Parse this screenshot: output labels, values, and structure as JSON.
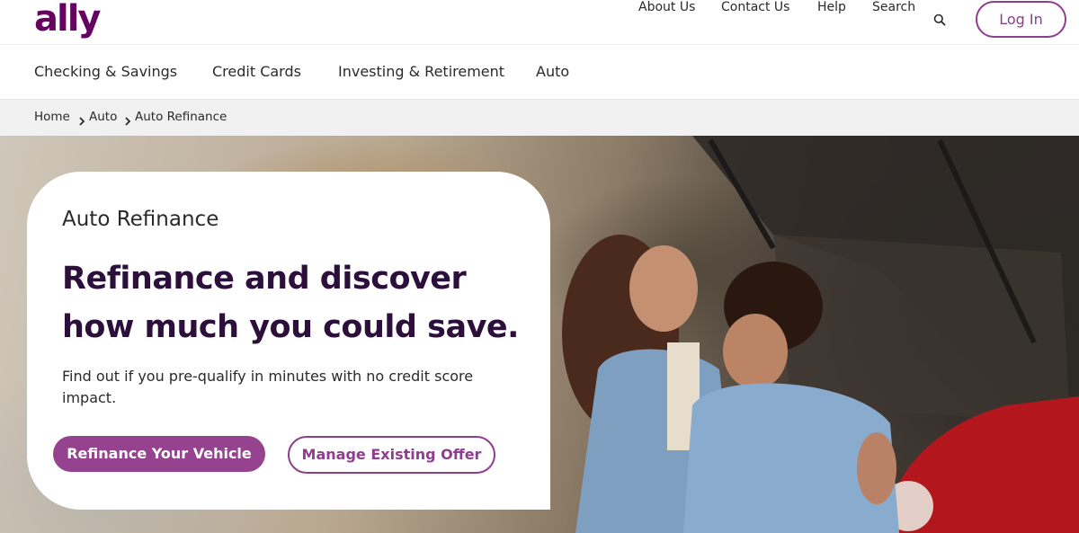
{
  "brand": {
    "logo_text": "ally",
    "accent_color": "#650360",
    "button_color": "#96438f"
  },
  "utility_nav": {
    "links": [
      "About Us",
      "Contact Us",
      "Help",
      "Search"
    ],
    "search_icon": "search-icon",
    "login_label": "Log In"
  },
  "main_nav": {
    "items": [
      "Checking & Savings",
      "Credit Cards",
      "Investing & Retirement",
      "Auto"
    ]
  },
  "breadcrumb": {
    "items": [
      "Home",
      "Auto",
      "Auto Refinance"
    ],
    "separator_icon": "chevron-right-icon"
  },
  "hero": {
    "eyebrow": "Auto Refinance",
    "headline_line1": "Refinance and discover",
    "headline_line2": "how much you could save.",
    "subtext": "Find out if you pre-qualify in minutes with no credit score impact.",
    "primary_button": "Refinance Your Vehicle",
    "secondary_button": "Manage Existing Offer"
  }
}
